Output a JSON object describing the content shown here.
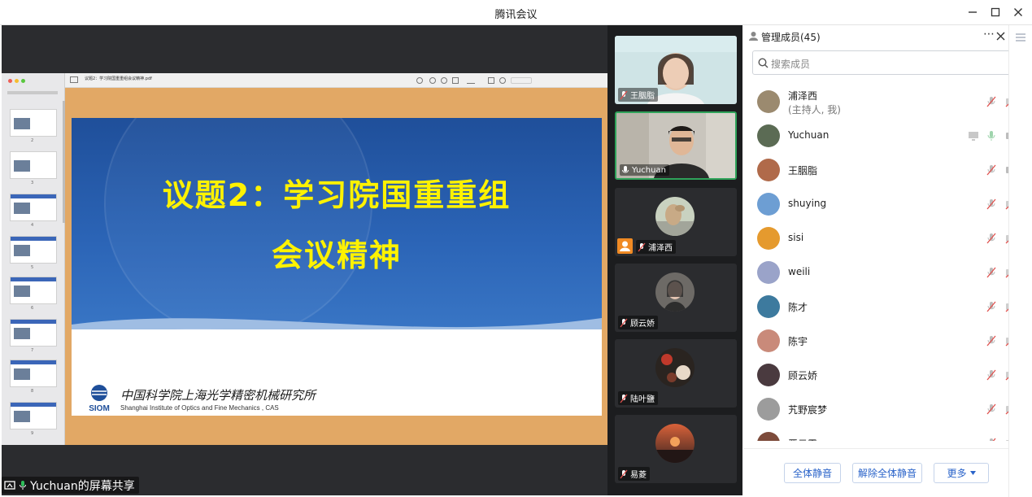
{
  "window": {
    "title": "腾讯会议"
  },
  "share": {
    "label": "Yuchuan的屏幕共享",
    "pdf_filename": "议题2：学习院国重重组会议精神.pdf"
  },
  "slide": {
    "line1": "议题2：学习院国重重组",
    "line2": "会议精神",
    "institute_cn": "中国科学院上海光学精密机械研究所",
    "institute_en": "Shanghai Institute  of Optics and Fine Mechanics , CAS",
    "logo_text": "SIOM"
  },
  "thumbnails": [
    "2",
    "3",
    "4",
    "5",
    "6",
    "7",
    "8",
    "9"
  ],
  "video_tiles": [
    {
      "name": "王胭脂",
      "muted": true
    },
    {
      "name": "Yuchuan",
      "muted": false,
      "active": true
    },
    {
      "name": "浦泽西",
      "muted": true
    },
    {
      "name": "顾云娇",
      "muted": true
    },
    {
      "name": "陆叶鹽",
      "muted": true
    },
    {
      "name": "易菱",
      "muted": true
    }
  ],
  "members": {
    "title": "管理成员(45)",
    "search_placeholder": "搜索成员",
    "list": [
      {
        "name": "浦泽西",
        "sub": "(主持人, 我)",
        "avatar": "#9b8a6f"
      },
      {
        "name": "Yuchuan",
        "sub": "",
        "avatar": "#5b6b54"
      },
      {
        "name": "王胭脂",
        "sub": "",
        "avatar": "#b06a4a"
      },
      {
        "name": "shuying",
        "sub": "",
        "avatar": "#6d9ed3"
      },
      {
        "name": "sisi",
        "sub": "",
        "avatar": "#e59a2e"
      },
      {
        "name": "weili",
        "sub": "",
        "avatar": "#9aa3c9"
      },
      {
        "name": "陈才",
        "sub": "",
        "avatar": "#3d7a9e"
      },
      {
        "name": "陈宇",
        "sub": "",
        "avatar": "#c98a7a"
      },
      {
        "name": "顾云娇",
        "sub": "",
        "avatar": "#4a3a3f"
      },
      {
        "name": "艽野宸梦",
        "sub": "",
        "avatar": "#9c9c9c"
      },
      {
        "name": "晋云霞",
        "sub": "",
        "avatar": "#7d4b3b"
      }
    ]
  },
  "footer": {
    "mute_all": "全体静音",
    "unmute_all": "解除全体静音",
    "more": "更多"
  },
  "colors": {
    "accent": "#2a63c9",
    "muted_red": "#e0514e",
    "active_green": "#2fa35a"
  }
}
